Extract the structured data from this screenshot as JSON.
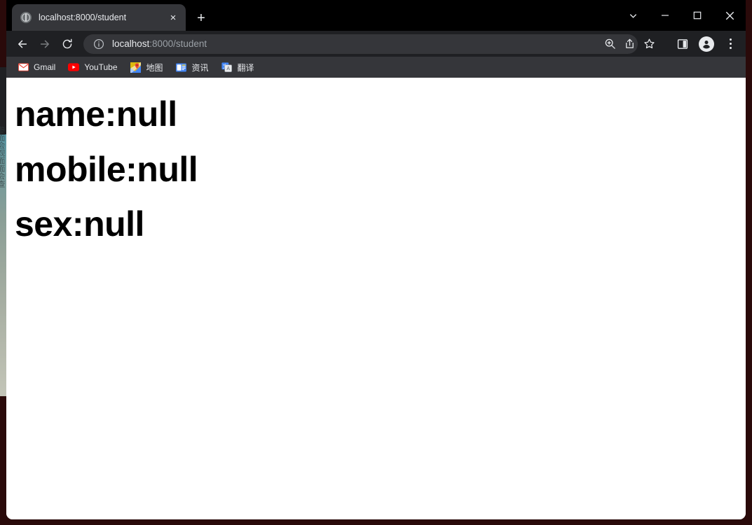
{
  "window": {
    "controls": [
      {
        "name": "tab-search",
        "glyph": "chevron-down"
      },
      {
        "name": "minimize",
        "glyph": "minimize"
      },
      {
        "name": "maximize",
        "glyph": "maximize"
      },
      {
        "name": "close",
        "glyph": "close"
      }
    ]
  },
  "tabstrip": {
    "tabs": [
      {
        "title": "localhost:8000/student",
        "favicon": "globe-icon",
        "close_label": "×",
        "active": true
      }
    ],
    "new_tab_label": "+"
  },
  "toolbar": {
    "back_label": "←",
    "forward_label": "→",
    "reload_label": "⟳",
    "omnibox": {
      "security_icon": "info-circle-icon",
      "url_host": "localhost",
      "url_rest": ":8000/student",
      "full_url": "localhost:8000/student"
    },
    "actions": [
      {
        "name": "zoom-icon",
        "title": "Zoom"
      },
      {
        "name": "share-icon",
        "title": "Share"
      },
      {
        "name": "bookmark-star-icon",
        "title": "Bookmark"
      }
    ],
    "side_panel_title": "Side panel",
    "profile_title": "Profile",
    "menu_title": "Customize and control Google Chrome"
  },
  "bookmarks": {
    "items": [
      {
        "label": "Gmail",
        "icon": "gmail-icon"
      },
      {
        "label": "YouTube",
        "icon": "youtube-icon"
      },
      {
        "label": "地图",
        "icon": "maps-icon"
      },
      {
        "label": "资讯",
        "icon": "news-icon"
      },
      {
        "label": "翻译",
        "icon": "translate-icon"
      }
    ]
  },
  "page": {
    "headings": [
      "name:null",
      "mobile:null",
      "sex:null"
    ]
  },
  "background_window": {
    "glyphs": "参面会观面面会查"
  },
  "colors": {
    "desktop_backdrop": "#2a0a0a",
    "tabstrip_bg": "#000000",
    "active_tab_bg": "#35363a",
    "toolbar_bg": "#1f2023",
    "omnibox_bg": "#35363a",
    "bookmarks_bg": "#35363a",
    "chrome_text": "#e8eaed",
    "chrome_text_dim": "#9aa0a6",
    "page_bg": "#ffffff",
    "page_text": "#000000"
  }
}
